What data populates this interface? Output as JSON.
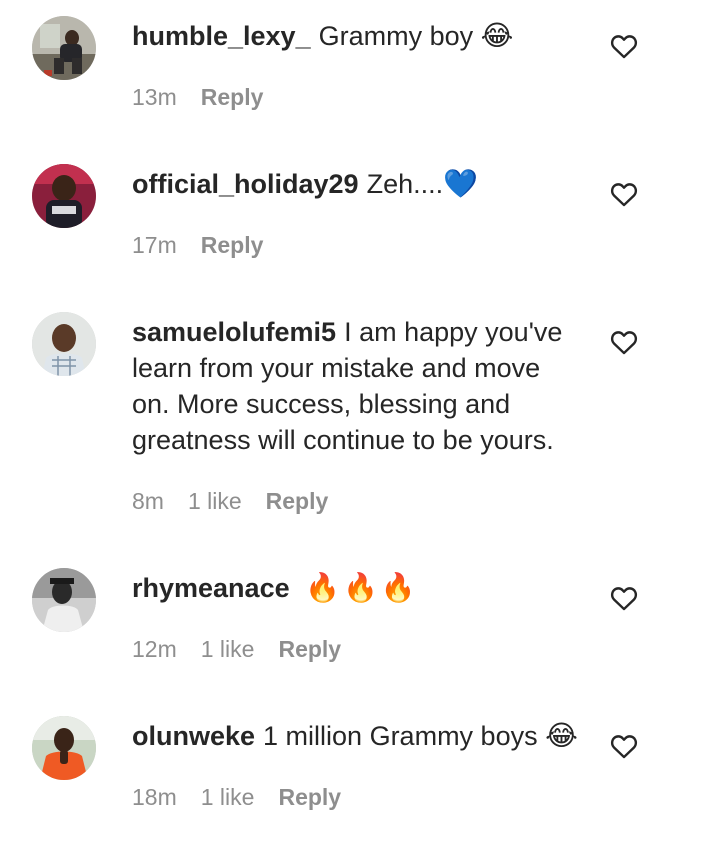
{
  "comments": [
    {
      "username": "humble_lexy_",
      "text": "Grammy boy",
      "emoji": "😂",
      "time": "13m",
      "likes": "",
      "reply_label": "Reply",
      "avatar_icon": "profile-photo-avatar",
      "like_icon": "heart-outline-icon"
    },
    {
      "username": "official_holiday29",
      "text": "Zeh....",
      "emoji": "💙",
      "time": "17m",
      "likes": "",
      "reply_label": "Reply",
      "avatar_icon": "profile-photo-avatar",
      "like_icon": "heart-outline-icon"
    },
    {
      "username": "samuelolufemi5",
      "text": "I am happy you've learn from your mistake and move on. More success, blessing and greatness will continue to be yours.",
      "emoji": "",
      "time": "8m",
      "likes": "1 like",
      "reply_label": "Reply",
      "avatar_icon": "profile-photo-avatar",
      "like_icon": "heart-outline-icon"
    },
    {
      "username": "rhymeanace",
      "text": "",
      "emoji": "🔥🔥🔥",
      "time": "12m",
      "likes": "1 like",
      "reply_label": "Reply",
      "avatar_icon": "profile-photo-avatar",
      "like_icon": "heart-outline-icon"
    },
    {
      "username": "olunweke",
      "text": "1 million Grammy boys",
      "emoji": "😂",
      "time": "18m",
      "likes": "1 like",
      "reply_label": "Reply",
      "avatar_icon": "profile-photo-avatar",
      "like_icon": "heart-outline-icon"
    }
  ],
  "colors": {
    "text": "#262626",
    "secondary": "#8e8e8e",
    "background": "#ffffff"
  }
}
